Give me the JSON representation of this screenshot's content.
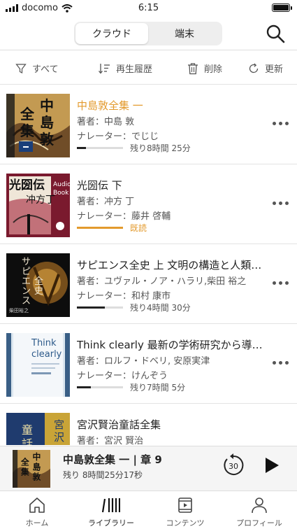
{
  "status": {
    "carrier": "docomo",
    "time": "6:15"
  },
  "segments": [
    {
      "label": "クラウド",
      "active": true
    },
    {
      "label": "端末",
      "active": false
    }
  ],
  "toolbar": {
    "all": "すべて",
    "history": "再生履歴",
    "delete": "削除",
    "refresh": "更新"
  },
  "books": [
    {
      "title": "中島敦全集 一",
      "author": "著者：中島 敦",
      "narrator": "ナレーター：でじじ",
      "progress": 0.2,
      "status": "残り8時間 25分",
      "title_color": "#E39A2D"
    },
    {
      "title": "光圀伝 下",
      "author": "著者：冲方 丁",
      "narrator": "ナレーター：藤井 啓輔",
      "progress": 1.0,
      "status": "既読",
      "status_color": "#E39A2D"
    },
    {
      "title": "サピエンス全史 上 文明の構造と人類の幸福",
      "author": "著者：ユヴァル・ノア・ハラリ,柴田 裕之",
      "narrator": "ナレーター：和村 康市",
      "progress": 0.6,
      "status": "残り4時間 30分"
    },
    {
      "title": "Think clearly 最新の学術研究から導いた、よりよい人生を送るための思考法",
      "author": "著者：ロルフ・ドベリ, 安原実津",
      "narrator": "ナレーター：けんぞう",
      "progress": 0.3,
      "status": "残り7時間 5分"
    },
    {
      "title": "宮沢賢治童話全集",
      "author": "著者：宮沢 賢治"
    }
  ],
  "covers": {
    "nakajima": {
      "text": "中島敦全集"
    },
    "koumon": {
      "text": "光圀伝",
      "author": "冲方丁",
      "label": "Audio Book"
    },
    "sapiens": {
      "text": "サピエンス全史",
      "sub": "柴田裕之"
    },
    "think": {
      "text": "Think clearly"
    },
    "miyazawa": {
      "text": "宮沢賢治童話全集"
    }
  },
  "player": {
    "title": "中島敦全集 一 | 章 9",
    "remaining": "残り 8時間25分17秒",
    "skip": "30"
  },
  "tabs": [
    {
      "label": "ホーム",
      "icon": "home-icon",
      "active": false
    },
    {
      "label": "ライブラリー",
      "icon": "library-icon",
      "active": true
    },
    {
      "label": "コンテンツ",
      "icon": "content-icon",
      "active": false
    },
    {
      "label": "プロフィール",
      "icon": "profile-icon",
      "active": false
    }
  ],
  "colors": {
    "accent": "#E39A2D",
    "progress": "#222222",
    "separator": "#E3E3E3"
  }
}
